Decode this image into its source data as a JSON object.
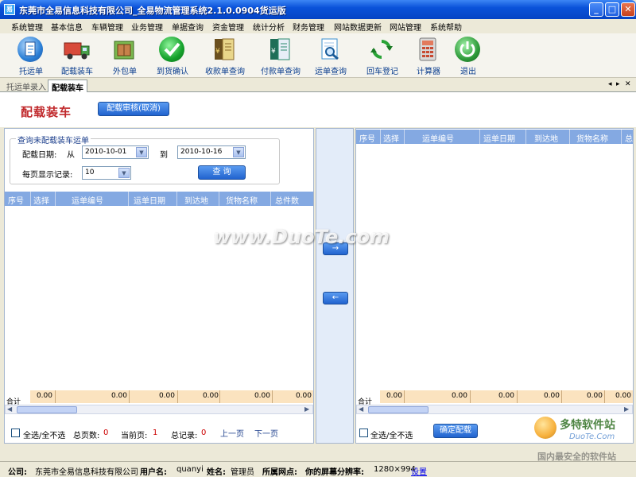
{
  "window": {
    "title": "东莞市全易信息科技有限公司_全易物流管理系统2.1.0.0904货运版",
    "app_icon": "易"
  },
  "menu": [
    "系统管理",
    "基本信息",
    "车辆管理",
    "业务管理",
    "单据查询",
    "资金管理",
    "统计分析",
    "财务管理",
    "网站数据更新",
    "网站管理",
    "系统帮助"
  ],
  "toolbar": [
    {
      "label": "托运单",
      "icon": "document-icon",
      "color": "#2b7fd6"
    },
    {
      "label": "配载装车",
      "icon": "truck-icon",
      "color": "#c63b2c"
    },
    {
      "label": "外包单",
      "icon": "package-icon",
      "color": "#4a9b3a"
    },
    {
      "label": "到货确认",
      "icon": "checkmark-icon",
      "color": "#15a12b"
    },
    {
      "label": "收款单查询",
      "icon": "receipt-icon",
      "color": "#8a6a2b"
    },
    {
      "label": "付款单查询",
      "icon": "payment-icon",
      "color": "#2b8a6e"
    },
    {
      "label": "运单查询",
      "icon": "search-doc-icon",
      "color": "#3a8fd0"
    },
    {
      "label": "回车登记",
      "icon": "refresh-icon",
      "color": "#29a336"
    },
    {
      "label": "计算器",
      "icon": "calculator-icon",
      "color": "#d0523a"
    },
    {
      "label": "退出",
      "icon": "power-icon",
      "color": "#2f9b3a"
    }
  ],
  "tabs": [
    "托运单录入",
    "配载装车"
  ],
  "tab_nav": {
    "prev": "◂",
    "next": "▸",
    "close": "✕"
  },
  "header": {
    "title": "配载装车",
    "cancel_button": "配载审核(取消)"
  },
  "query": {
    "legend": "查询未配载装车运单",
    "date_label": "配载日期:",
    "from_label": "从",
    "from_value": "2010-10-01",
    "to_label": "到",
    "to_value": "2010-10-16",
    "per_page_label": "每页显示记录:",
    "per_page_value": "10",
    "query_button": "查  询"
  },
  "left_grid": {
    "columns": [
      "序号",
      "选择",
      "运单编号",
      "运单日期",
      "到达地",
      "货物名称",
      "总件数"
    ],
    "sum_label": "合计",
    "sums": [
      "0.00",
      "0.00",
      "0.00",
      "0.00",
      "0.00",
      "0.00",
      "0.00"
    ]
  },
  "right_grid": {
    "columns": [
      "序号",
      "选择",
      "运单编号",
      "运单日期",
      "到达地",
      "货物名称",
      "总"
    ],
    "sum_label": "合计",
    "sums": [
      "0.00",
      "0.00",
      "0.00",
      "0.00",
      "0.00",
      "0.00"
    ]
  },
  "transfer": {
    "right_arrow": "→",
    "left_arrow": "←"
  },
  "left_footer": {
    "select_all": "全选/全不选",
    "total_pages_label": "总页数:",
    "total_pages": "0",
    "current_page_label": "当前页:",
    "current_page": "1",
    "total_records_label": "总记录:",
    "total_records": "0",
    "prev": "上一页",
    "next": "下一页"
  },
  "right_footer": {
    "select_all": "全选/全不选",
    "confirm_button": "确定配载"
  },
  "watermark": {
    "text": "www.DuoTe.com",
    "logo_text": "多特软件站",
    "logo_sub": "DuoTe.Com",
    "slogan": "国内最安全的软件站"
  },
  "status": {
    "company_label": "公司:",
    "company": "东莞市全易信息科技有限公司",
    "user_label": "用户名:",
    "user": "quanyi",
    "name_label": "姓名:",
    "name": "管理员",
    "site_label": "所属网点:",
    "resolution_label": "你的屏幕分辨率:",
    "resolution": "1280×994",
    "settings": "设置"
  }
}
